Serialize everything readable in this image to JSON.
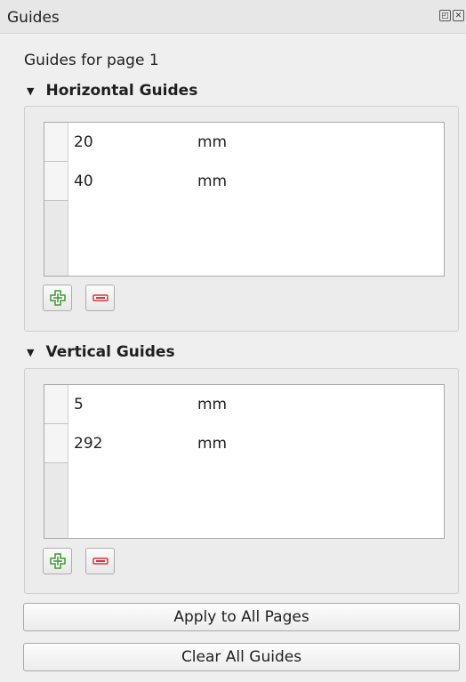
{
  "panel": {
    "title": "Guides",
    "float_icon": "float-icon",
    "close_icon": "close-icon"
  },
  "page_label": "Guides for page 1",
  "horizontal": {
    "header": "Horizontal Guides",
    "rows": [
      {
        "value": "20",
        "unit": "mm"
      },
      {
        "value": "40",
        "unit": "mm"
      }
    ],
    "add_icon": "add-icon",
    "remove_icon": "remove-icon"
  },
  "vertical": {
    "header": "Vertical Guides",
    "rows": [
      {
        "value": "5",
        "unit": "mm"
      },
      {
        "value": "292",
        "unit": "mm"
      }
    ],
    "add_icon": "add-icon",
    "remove_icon": "remove-icon"
  },
  "buttons": {
    "apply_all": "Apply to All Pages",
    "clear_all": "Clear All Guides"
  },
  "colors": {
    "add_green": "#3a9a2f",
    "remove_red": "#d9333d"
  }
}
